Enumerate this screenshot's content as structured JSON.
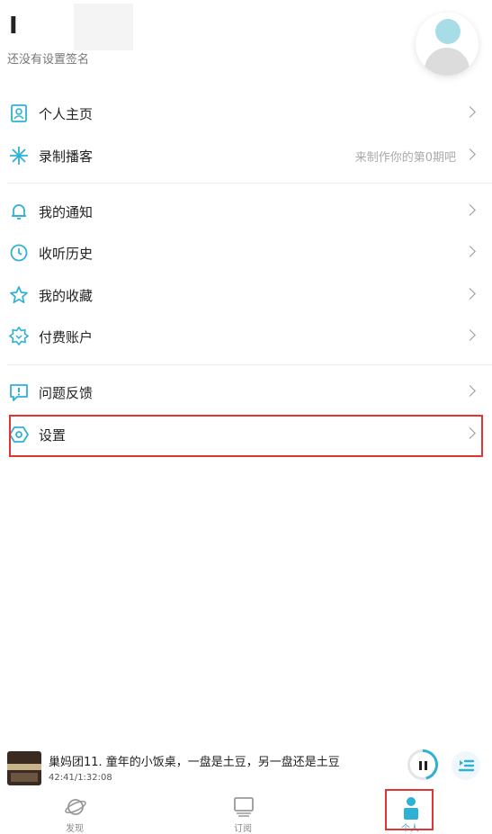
{
  "header": {
    "username": "I",
    "signature": "还没有设置签名"
  },
  "menu": {
    "items": [
      {
        "label": "个人主页",
        "icon": "profile-card-icon",
        "hint": ""
      },
      {
        "label": "录制播客",
        "icon": "sparkle-icon",
        "hint": "来制作你的第0期吧"
      },
      {
        "label": "我的通知",
        "icon": "bell-icon",
        "hint": ""
      },
      {
        "label": "收听历史",
        "icon": "clock-icon",
        "hint": ""
      },
      {
        "label": "我的收藏",
        "icon": "star-icon",
        "hint": ""
      },
      {
        "label": "付费账户",
        "icon": "badge-icon",
        "hint": ""
      },
      {
        "label": "问题反馈",
        "icon": "feedback-icon",
        "hint": ""
      },
      {
        "label": "设置",
        "icon": "settings-hexagon-icon",
        "hint": ""
      }
    ]
  },
  "player": {
    "title": "巢妈团11. 童年的小饭桌，一盘是土豆，另一盘还是土豆",
    "time": "42:41/1:32:08",
    "progress": 0.46
  },
  "tabs": [
    {
      "label": "发现",
      "icon": "planet-icon"
    },
    {
      "label": "订阅",
      "icon": "monitor-icon"
    },
    {
      "label": "个人",
      "icon": "person-icon"
    }
  ],
  "colors": {
    "accent": "#2fb1d6",
    "highlight_border": "#e03535"
  }
}
